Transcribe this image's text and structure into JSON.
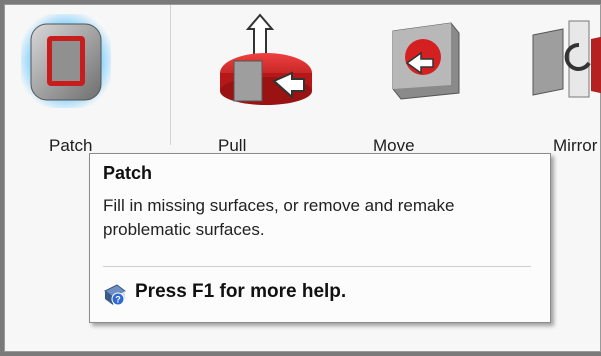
{
  "ribbon": {
    "tools": [
      {
        "label": "Patch",
        "icon": "patch-icon"
      },
      {
        "label": "Pull",
        "icon": "pull-icon"
      },
      {
        "label": "Move",
        "icon": "move-face-icon"
      },
      {
        "label": "Mirror",
        "icon": "mirror-icon"
      }
    ]
  },
  "tooltip": {
    "title": "Patch",
    "description": "Fill in missing surfaces, or remove and remake problematic surfaces.",
    "help_text": "Press F1 for more help.",
    "help_icon": "help-book-icon"
  },
  "colors": {
    "accent_red": "#d42020",
    "selection_glow": "#4fb8ff",
    "steel_gray": "#8f8f8f"
  }
}
